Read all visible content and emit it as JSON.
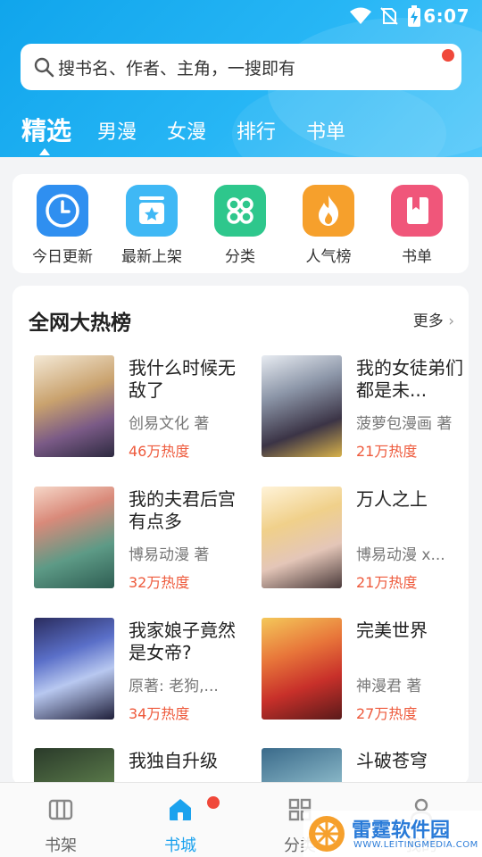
{
  "status": {
    "time": "6:07"
  },
  "search": {
    "placeholder": "搜书名、作者、主角，一搜即有"
  },
  "tabs": [
    "精选",
    "男漫",
    "女漫",
    "排行",
    "书单"
  ],
  "quick": [
    {
      "label": "今日更新",
      "icon": "clock-icon",
      "color": "#2f8ff0"
    },
    {
      "label": "最新上架",
      "icon": "star-box-icon",
      "color": "#3fb8f5"
    },
    {
      "label": "分类",
      "icon": "grid-icon",
      "color": "#2ec78c"
    },
    {
      "label": "人气榜",
      "icon": "flame-icon",
      "color": "#f6a02c"
    },
    {
      "label": "书单",
      "icon": "bookmark-icon",
      "color": "#f0567a"
    }
  ],
  "hot": {
    "title": "全网大热榜",
    "more": "更多",
    "books": [
      {
        "title": "我什么时候无敌了",
        "author": "创易文化 著",
        "heat": "46万热度"
      },
      {
        "title": "我的女徒弟们都是未...",
        "author": "菠萝包漫画 著",
        "heat": "21万热度"
      },
      {
        "title": "我的夫君后宫有点多",
        "author": "博易动漫 著",
        "heat": "32万热度"
      },
      {
        "title": "万人之上",
        "author": "博易动漫 x...",
        "heat": "21万热度"
      },
      {
        "title": "我家娘子竟然是女帝?",
        "author": "原著: 老狗,...",
        "heat": "34万热度"
      },
      {
        "title": "完美世界",
        "author": "神漫君 著",
        "heat": "27万热度"
      },
      {
        "title": "我独自升级",
        "author": "",
        "heat": ""
      },
      {
        "title": "斗破苍穹",
        "author": "",
        "heat": ""
      }
    ]
  },
  "nav": [
    "书架",
    "书城",
    "分类",
    "我的"
  ],
  "watermark": {
    "title": "雷霆软件园",
    "sub": "WWW.LEITINGMEDIA.COM"
  }
}
